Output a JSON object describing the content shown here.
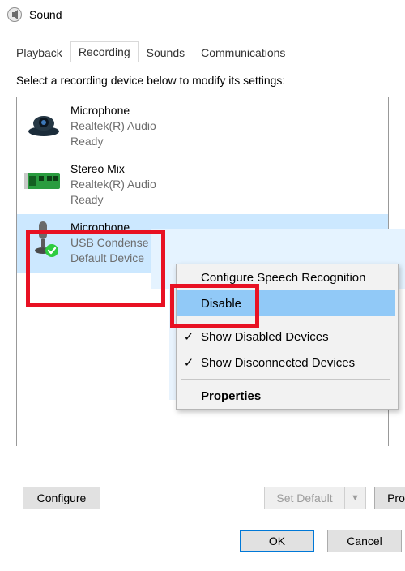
{
  "window": {
    "title": "Sound"
  },
  "tabs": {
    "playback": "Playback",
    "recording": "Recording",
    "sounds": "Sounds",
    "communications": "Communications",
    "active": "recording"
  },
  "instruction": "Select a recording device below to modify its settings:",
  "devices": [
    {
      "name": "Microphone",
      "sub": "Realtek(R) Audio",
      "state": "Ready"
    },
    {
      "name": "Stereo Mix",
      "sub": "Realtek(R) Audio",
      "state": "Ready"
    },
    {
      "name": "Microphone",
      "sub": "USB Condense",
      "state": "Default Device"
    }
  ],
  "context_menu": {
    "configure": "Configure Speech Recognition",
    "disable": "Disable",
    "show_disabled": "Show Disabled Devices",
    "show_disconnected": "Show Disconnected Devices",
    "properties": "Properties"
  },
  "buttons": {
    "configure": "Configure",
    "set_default": "Set Default",
    "properties_short": "Pro",
    "ok": "OK",
    "cancel": "Cancel"
  }
}
